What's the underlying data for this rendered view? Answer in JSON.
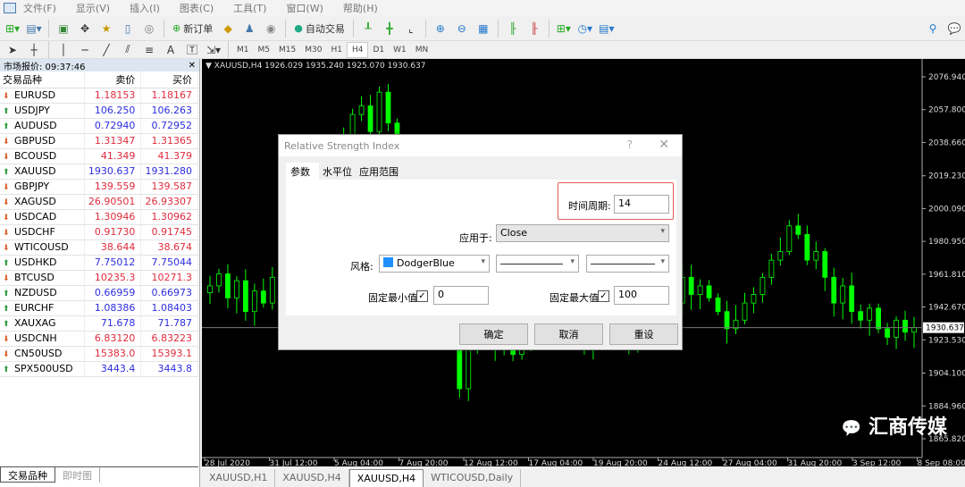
{
  "menu": [
    "文件(F)",
    "显示(V)",
    "插入(I)",
    "图表(C)",
    "工具(T)",
    "窗口(W)",
    "帮助(H)"
  ],
  "toolbar": {
    "new_order": "新订单",
    "auto_trading": "自动交易",
    "timeframes": [
      "M1",
      "M5",
      "M15",
      "M30",
      "H1",
      "H4",
      "D1",
      "W1",
      "MN"
    ],
    "active_timeframe": "H4"
  },
  "market_watch": {
    "title": "市场报价: 09:37:46",
    "columns": [
      "交易品种",
      "卖价",
      "买价"
    ],
    "rows": [
      {
        "symbol": "EURUSD",
        "bid": "1.18153",
        "ask": "1.18167",
        "dir": "down"
      },
      {
        "symbol": "USDJPY",
        "bid": "106.250",
        "ask": "106.263",
        "dir": "up"
      },
      {
        "symbol": "AUDUSD",
        "bid": "0.72940",
        "ask": "0.72952",
        "dir": "up"
      },
      {
        "symbol": "GBPUSD",
        "bid": "1.31347",
        "ask": "1.31365",
        "dir": "down"
      },
      {
        "symbol": "BCOUSD",
        "bid": "41.349",
        "ask": "41.379",
        "dir": "down"
      },
      {
        "symbol": "XAUUSD",
        "bid": "1930.637",
        "ask": "1931.280",
        "dir": "up"
      },
      {
        "symbol": "GBPJPY",
        "bid": "139.559",
        "ask": "139.587",
        "dir": "down"
      },
      {
        "symbol": "XAGUSD",
        "bid": "26.90501",
        "ask": "26.93307",
        "dir": "down"
      },
      {
        "symbol": "USDCAD",
        "bid": "1.30946",
        "ask": "1.30962",
        "dir": "down"
      },
      {
        "symbol": "USDCHF",
        "bid": "0.91730",
        "ask": "0.91745",
        "dir": "down"
      },
      {
        "symbol": "WTICOUSD",
        "bid": "38.644",
        "ask": "38.674",
        "dir": "down"
      },
      {
        "symbol": "USDHKD",
        "bid": "7.75012",
        "ask": "7.75044",
        "dir": "up"
      },
      {
        "symbol": "BTCUSD",
        "bid": "10235.3",
        "ask": "10271.3",
        "dir": "down"
      },
      {
        "symbol": "NZDUSD",
        "bid": "0.66959",
        "ask": "0.66973",
        "dir": "up"
      },
      {
        "symbol": "EURCHF",
        "bid": "1.08386",
        "ask": "1.08403",
        "dir": "up"
      },
      {
        "symbol": "XAUXAG",
        "bid": "71.678",
        "ask": "71.787",
        "dir": "up"
      },
      {
        "symbol": "USDCNH",
        "bid": "6.83120",
        "ask": "6.83223",
        "dir": "down"
      },
      {
        "symbol": "CN50USD",
        "bid": "15383.0",
        "ask": "15393.1",
        "dir": "down"
      },
      {
        "symbol": "SPX500USD",
        "bid": "3443.4",
        "ask": "3443.8",
        "dir": "up"
      }
    ],
    "tabs": [
      "交易品种",
      "即时图"
    ]
  },
  "chart": {
    "header": "XAUUSD,H4  1926.029 1935.240 1925.070 1930.637",
    "current_price": "1930.637",
    "price_labels": [
      "2076.940",
      "2057.800",
      "2038.660",
      "2019.230",
      "2000.090",
      "1980.950",
      "1961.810",
      "1942.670",
      "1923.530",
      "1904.100",
      "1884.960",
      "1865.820"
    ],
    "time_labels": [
      "28 Jul 2020",
      "31 Jul 12:00",
      "5 Aug 04:00",
      "7 Aug 20:00",
      "12 Aug 12:00",
      "17 Aug 04:00",
      "19 Aug 20:00",
      "24 Aug 12:00",
      "27 Aug 04:00",
      "31 Aug 20:00",
      "3 Sep 12:00",
      "8 Sep 08:00"
    ],
    "candle_color": "#00ff00",
    "closes": [
      1955,
      1962,
      1948,
      1958,
      1940,
      1952,
      1945,
      1960,
      1970,
      1985,
      1990,
      2000,
      2015,
      2020,
      2035,
      2040,
      2055,
      2060,
      2045,
      2068,
      2050,
      2030,
      2025,
      2035,
      2010,
      1980,
      1960,
      1925,
      1895,
      1920,
      1930,
      1945,
      1920,
      1935,
      1915,
      1925,
      1940,
      1955,
      1940,
      1930,
      1945,
      1925,
      1920,
      1935,
      1950,
      1940,
      1930,
      1925,
      1935,
      1950,
      1955,
      1940,
      1945,
      1960,
      1950,
      1955,
      1948,
      1940,
      1930,
      1935,
      1945,
      1950,
      1960,
      1970,
      1975,
      1990,
      1985,
      1970,
      1975,
      1960,
      1945,
      1955,
      1940,
      1935,
      1942,
      1930,
      1925,
      1935,
      1928,
      1930.637
    ]
  },
  "chart_tabs": [
    "XAUUSD,H1",
    "XAUUSD,H4",
    "XAUUSD,H4",
    "WTICOUSD,Daily"
  ],
  "active_chart_tab": 2,
  "dialog": {
    "title": "Relative Strength Index",
    "help": "?",
    "close": "✕",
    "tabs": [
      "参数",
      "水平位",
      "应用范围"
    ],
    "period_label": "时间周期:",
    "period_value": "14",
    "apply_label": "应用于:",
    "apply_value": "Close",
    "style_label": "风格:",
    "color_name": "DodgerBlue",
    "color_hex": "#1e90ff",
    "fixed_min_label": "固定最小值",
    "fixed_min_value": "0",
    "fixed_min_checked": true,
    "fixed_max_label": "固定最大值",
    "fixed_max_value": "100",
    "fixed_max_checked": true,
    "ok": "确定",
    "cancel": "取消",
    "reset": "重设"
  },
  "watermark": "汇商传媒"
}
